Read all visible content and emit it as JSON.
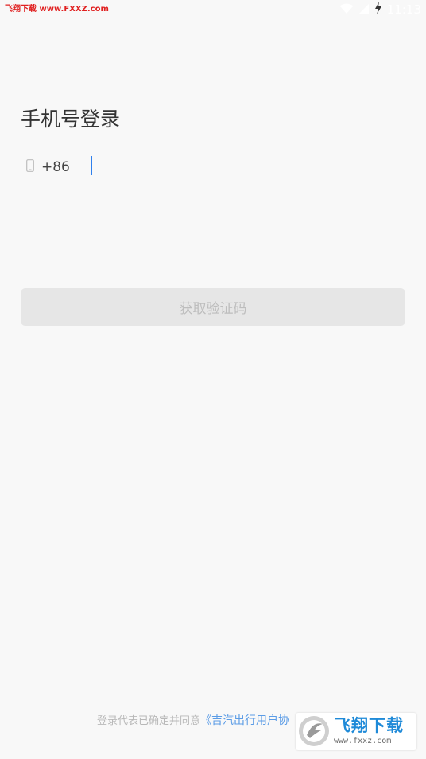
{
  "status_bar": {
    "watermark_text": "飞翔下载 www.FXXZ.com",
    "time": "11:13",
    "wifi_icon": "wifi-icon",
    "signal_icon": "signal-icon",
    "charging_icon": "charging-icon"
  },
  "login": {
    "title": "手机号登录",
    "phone_icon": "phone-icon",
    "country_code": "+86",
    "phone_value": "",
    "get_code_label": "获取验证码"
  },
  "agreement": {
    "prefix": "登录代表已确定并同意",
    "link": "《吉汽出行用户协"
  },
  "watermark": {
    "logo_icon": "fxxz-logo-icon",
    "name": "飞翔下载",
    "url": "www.fxxz.com"
  },
  "colors": {
    "background": "#f8f8f8",
    "title_text": "#333333",
    "caret": "#2f80ed",
    "button_bg": "#e6e6e6",
    "button_text": "#bdbdbd",
    "link": "#5b9ce6",
    "watermark_red": "#e02020",
    "watermark_blue": "#1f8ad8"
  }
}
